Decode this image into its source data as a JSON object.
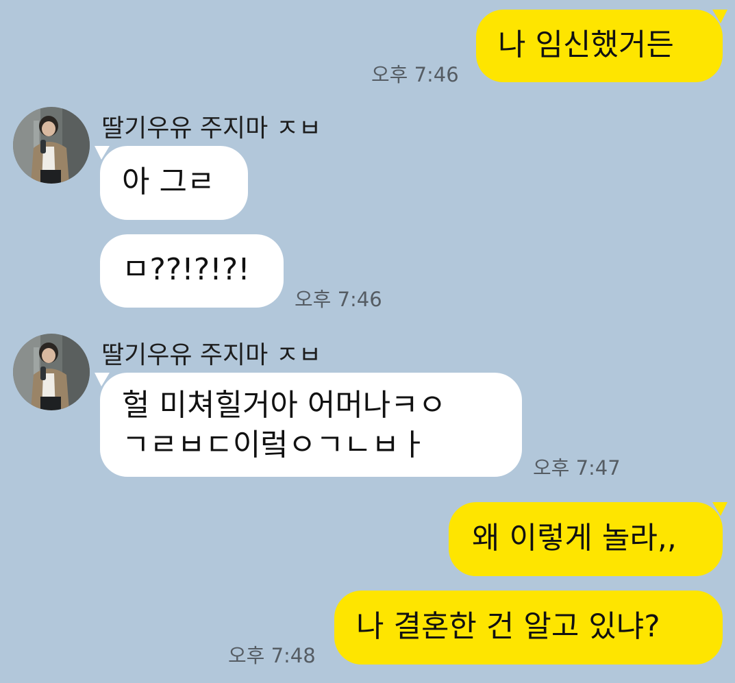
{
  "chat": {
    "messages": [
      {
        "side": "mine",
        "text": "나 임신했거든",
        "time": "오후 7:46"
      },
      {
        "side": "theirs",
        "sender": "딸기우유 주지마 ㅈㅂ",
        "text": "아 그ㄹ"
      },
      {
        "side": "theirs",
        "text": "ㅁ??!?!?!",
        "time": "오후 7:46"
      },
      {
        "side": "theirs",
        "sender": "딸기우유 주지마 ㅈㅂ",
        "line1": "헐 미쳐힐거아 어머나ㅋㅇ",
        "line2": "ㄱㄹㅂㄷ이렄ㅇㄱㄴㅂㅏ",
        "time": "오후 7:47"
      },
      {
        "side": "mine",
        "text": "왜 이렇게 놀라,,"
      },
      {
        "side": "mine",
        "text": "나 결혼한 건 알고 있냐?",
        "time": "오후 7:48"
      }
    ]
  },
  "colors": {
    "background": "#b2c7da",
    "my_bubble": "#fee500",
    "their_bubble": "#ffffff",
    "time_text": "#555c63"
  },
  "icons": {
    "avatar": "profile-photo-avatar"
  }
}
